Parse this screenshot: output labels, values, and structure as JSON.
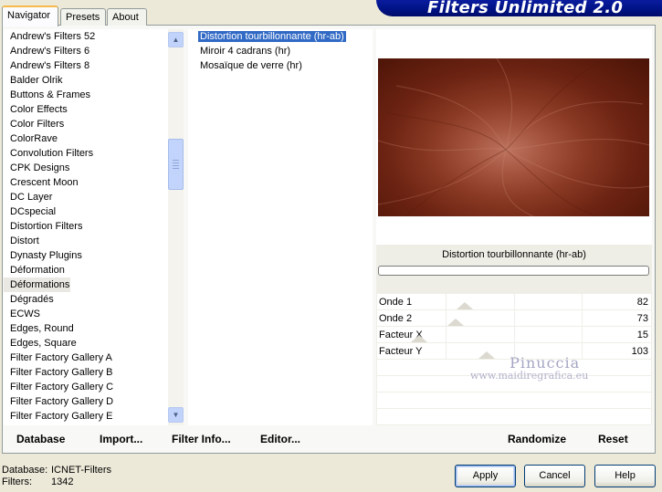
{
  "window": {
    "title": "Filters Unlimited 2.0"
  },
  "tabs": [
    {
      "label": "Navigator",
      "active": true
    },
    {
      "label": "Presets",
      "active": false
    },
    {
      "label": "About",
      "active": false
    }
  ],
  "categories": {
    "items": [
      "Andrew's Filters 52",
      "Andrew's Filters 6",
      "Andrew's Filters 8",
      "Balder Olrik",
      "Buttons & Frames",
      "Color Effects",
      "Color Filters",
      "ColorRave",
      "Convolution Filters",
      "CPK Designs",
      "Crescent Moon",
      "DC Layer",
      "DCspecial",
      "Distortion Filters",
      "Distort",
      "Dynasty Plugins",
      "Déformation",
      "Déformations",
      "Dégradés",
      "ECWS",
      "Edges, Round",
      "Edges, Square",
      "Filter Factory Gallery A",
      "Filter Factory Gallery B",
      "Filter Factory Gallery C",
      "Filter Factory Gallery D",
      "Filter Factory Gallery E"
    ],
    "selected": "Déformations"
  },
  "filters": {
    "items": [
      "Distortion tourbillonnante (hr-ab)",
      "Miroir 4 cadrans (hr)",
      "Mosaïque de verre (hr)"
    ],
    "selected": "Distortion tourbillonnante (hr-ab)"
  },
  "preview": {
    "filter_name": "Distortion tourbillonnante (hr-ab)"
  },
  "parameters": [
    {
      "label": "Onde 1",
      "value": "82"
    },
    {
      "label": "Onde 2",
      "value": "73"
    },
    {
      "label": "Facteur X",
      "value": "15"
    },
    {
      "label": "Facteur Y",
      "value": "103"
    }
  ],
  "watermark": {
    "line1": "Pinuccia",
    "line2": "www.maidiregrafica.eu"
  },
  "toolbar": {
    "database": "Database",
    "import": "Import...",
    "filter_info": "Filter Info...",
    "editor": "Editor...",
    "randomize": "Randomize",
    "reset": "Reset"
  },
  "status": {
    "database_label": "Database:",
    "database_value": "ICNET-Filters",
    "filters_label": "Filters:",
    "filters_value": "1342"
  },
  "buttons": {
    "apply": "Apply",
    "cancel": "Cancel",
    "help": "Help"
  },
  "colors": {
    "banner": "#001282",
    "selection": "#316ac5",
    "preview_base": "#8a3a24"
  }
}
